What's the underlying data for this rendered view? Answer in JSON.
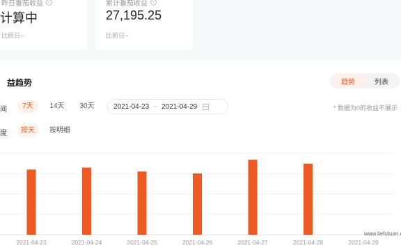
{
  "stats": {
    "yesterday": {
      "label": "昨日番茄收益",
      "value": "计算中",
      "sub": "比前日--"
    },
    "total": {
      "label": "累计番茄收益",
      "value": "27,195.25",
      "sub": "比前日--"
    }
  },
  "trend": {
    "title": "益趋势",
    "view_toggle": {
      "trend_label": "趋势",
      "list_label": "列表",
      "selected": "趋势"
    },
    "time_row": {
      "label": "间",
      "options": [
        "7天",
        "14天",
        "30天"
      ],
      "selected": "7天",
      "start_date": "2021-04-23",
      "date_sep": "~",
      "end_date": "2021-04-29"
    },
    "dim_row": {
      "label": "度",
      "options": [
        "按天",
        "按明细"
      ],
      "selected": "按天"
    },
    "note": "* 数据为0的收益不展示"
  },
  "chart_data": {
    "type": "bar",
    "categories": [
      "2021-04-23",
      "2021-04-24",
      "2021-04-25",
      "2021-04-26",
      "2021-04-27",
      "2021-04-28",
      "2021-04-29"
    ],
    "values": [
      100,
      103,
      97,
      94,
      115,
      109,
      0
    ],
    "ylim": [
      0,
      125
    ],
    "grid": true,
    "color": "#ee5a24"
  },
  "watermark": "www.liefutuan.com"
}
